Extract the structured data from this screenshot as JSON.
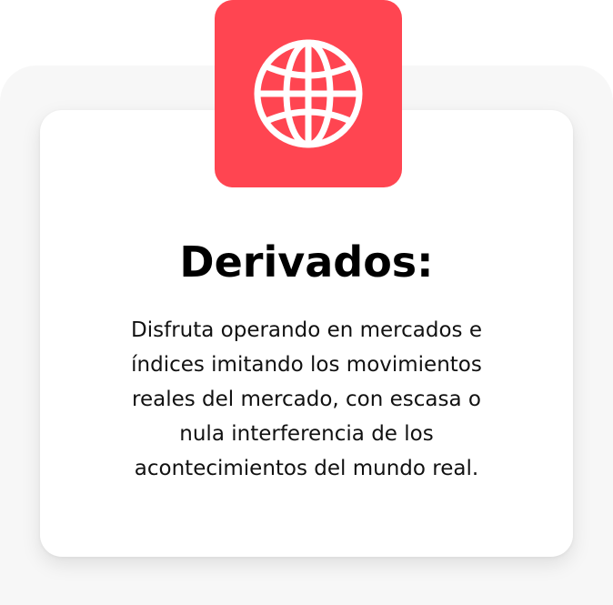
{
  "feature": {
    "title": "Derivados:",
    "description_lines": [
      "Disfruta operando en mercados e",
      "índices imitando los movimientos",
      "reales del mercado, con escasa o",
      "nula interferencia de los",
      "acontecimientos del mundo real."
    ],
    "icon": "globe-icon"
  },
  "colors": {
    "accent": "#ff4551",
    "icon_stroke": "#ffffff",
    "outer_panel": "#f7f7f7",
    "card": "#ffffff",
    "text": "#000000"
  }
}
